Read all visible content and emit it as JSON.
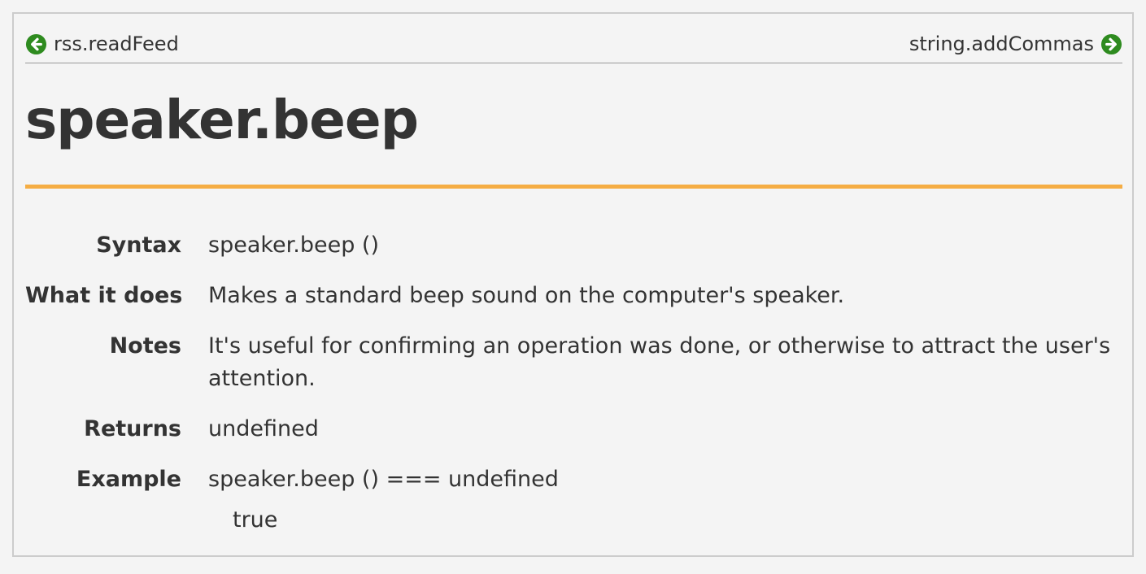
{
  "nav": {
    "prev_label": "rss.readFeed",
    "next_label": "string.addCommas",
    "prev_icon": "arrow-left-circle-icon",
    "next_icon": "arrow-right-circle-icon",
    "icon_color": "#2e8b1f"
  },
  "page": {
    "title": "speaker.beep",
    "rule_color": "#f5ad44"
  },
  "doc": {
    "syntax_label": "Syntax",
    "syntax_value": "speaker.beep ()",
    "does_label": "What it does",
    "does_value": "Makes a standard beep sound on the computer's speaker.",
    "notes_label": "Notes",
    "notes_value": "It's useful for confirming an operation was done, or otherwise to attract the user's attention.",
    "returns_label": "Returns",
    "returns_value": "undefined",
    "example_label": "Example",
    "example_code": "speaker.beep () === undefined",
    "example_result": "true"
  }
}
